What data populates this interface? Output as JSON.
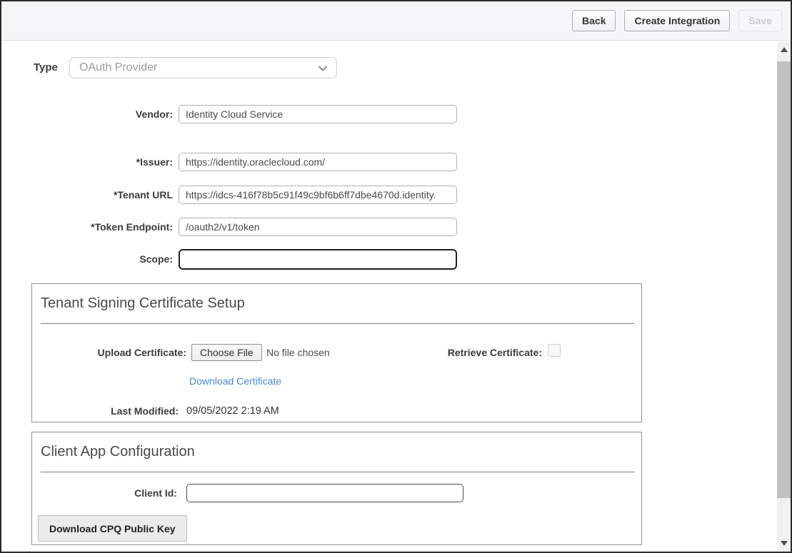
{
  "toolbar": {
    "back_label": "Back",
    "create_integration_label": "Create Integration",
    "save_label": "Save"
  },
  "form": {
    "type_label": "Type",
    "type_value": "OAuth Provider",
    "vendor_label": "Vendor:",
    "vendor_value": "Identity Cloud Service",
    "issuer_label": "*Issuer:",
    "issuer_value": "https://identity.oraclecloud.com/",
    "tenant_url_label": "*Tenant URL",
    "tenant_url_value": "https://idcs-416f78b5c91f49c9bf6b6ff7dbe4670d.identity.",
    "token_endpoint_label": "*Token Endpoint:",
    "token_endpoint_value": "/oauth2/v1/token",
    "scope_label": "Scope:",
    "scope_value": ""
  },
  "certificate_section": {
    "title": "Tenant Signing Certificate Setup",
    "upload_certificate_label": "Upload Certificate:",
    "choose_file_label": "Choose File",
    "file_status": "No file chosen",
    "retrieve_certificate_label": "Retrieve Certificate:",
    "retrieve_certificate_checked": false,
    "download_certificate_link": "Download Certificate",
    "last_modified_label": "Last Modified:",
    "last_modified_value": "09/05/2022 2:19 AM"
  },
  "client_section": {
    "title": "Client App Configuration",
    "client_id_label": "Client Id:",
    "client_id_value": "",
    "download_cpq_public_key_label": "Download CPQ Public Key"
  },
  "colors": {
    "link_blue": "#4a89c7",
    "toolbar_background": "#f5f6f7",
    "outer_border": "#2b2b2b",
    "focused_field_border": "#1f1f1f",
    "scrollbar_thumb": "#c2c2c2"
  }
}
